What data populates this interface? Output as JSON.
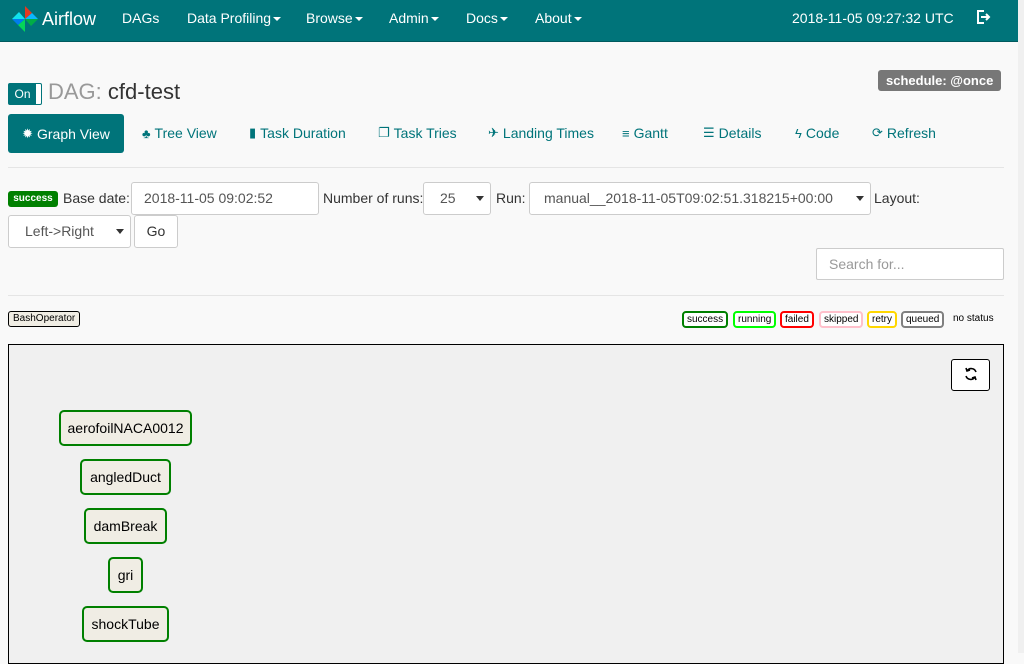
{
  "navbar": {
    "brand": "Airflow",
    "items": [
      {
        "label": "DAGs",
        "dropdown": false
      },
      {
        "label": "Data Profiling",
        "dropdown": true
      },
      {
        "label": "Browse",
        "dropdown": true
      },
      {
        "label": "Admin",
        "dropdown": true
      },
      {
        "label": "Docs",
        "dropdown": true
      },
      {
        "label": "About",
        "dropdown": true
      }
    ],
    "clock": "2018-11-05 09:27:32 UTC",
    "logout_icon": "sign-out-icon"
  },
  "dag": {
    "toggle_label": "On",
    "title_prefix": "DAG:",
    "title_name": "cfd-test",
    "schedule": "schedule: @once"
  },
  "tabs": [
    {
      "label": "Graph View",
      "icon": "asterisk-icon",
      "active": true
    },
    {
      "label": "Tree View",
      "icon": "tree-icon",
      "active": false
    },
    {
      "label": "Task Duration",
      "icon": "stats-icon",
      "active": false
    },
    {
      "label": "Task Tries",
      "icon": "duplicate-icon",
      "active": false
    },
    {
      "label": "Landing Times",
      "icon": "plane-icon",
      "active": false
    },
    {
      "label": "Gantt",
      "icon": "align-left-icon",
      "active": false
    },
    {
      "label": "Details",
      "icon": "list-icon",
      "active": false
    },
    {
      "label": "Code",
      "icon": "flash-icon",
      "active": false
    },
    {
      "label": "Refresh",
      "icon": "refresh-icon",
      "active": false
    }
  ],
  "form": {
    "state_badge": "success",
    "base_date_label": "Base date:",
    "base_date_value": "2018-11-05 09:02:52",
    "num_runs_label": "Number of runs:",
    "num_runs_value": "25",
    "run_label": "Run:",
    "run_value": "manual__2018-11-05T09:02:51.318215+00:00",
    "layout_label": "Layout:",
    "layout_value": "Left->Right",
    "go_label": "Go",
    "search_placeholder": "Search for..."
  },
  "legend": {
    "operator": "BashOperator",
    "operator_color": "#f0ede4",
    "states": [
      {
        "label": "success",
        "color": "#008000"
      },
      {
        "label": "running",
        "color": "#00ff00"
      },
      {
        "label": "failed",
        "color": "#ff0000"
      },
      {
        "label": "skipped",
        "color": "#ffc0cb"
      },
      {
        "label": "retry",
        "color": "#ffd700"
      },
      {
        "label": "queued",
        "color": "#808080"
      }
    ],
    "no_status": "no status"
  },
  "graph": {
    "refresh_icon": "refresh-icon",
    "nodes": [
      {
        "label": "aerofoilNACA0012",
        "state": "success"
      },
      {
        "label": "angledDuct",
        "state": "success"
      },
      {
        "label": "damBreak",
        "state": "success"
      },
      {
        "label": "gri",
        "state": "success"
      },
      {
        "label": "shockTube",
        "state": "success"
      }
    ]
  },
  "colors": {
    "navbar": "#00747a",
    "accent": "#00747a",
    "success": "#008000"
  }
}
